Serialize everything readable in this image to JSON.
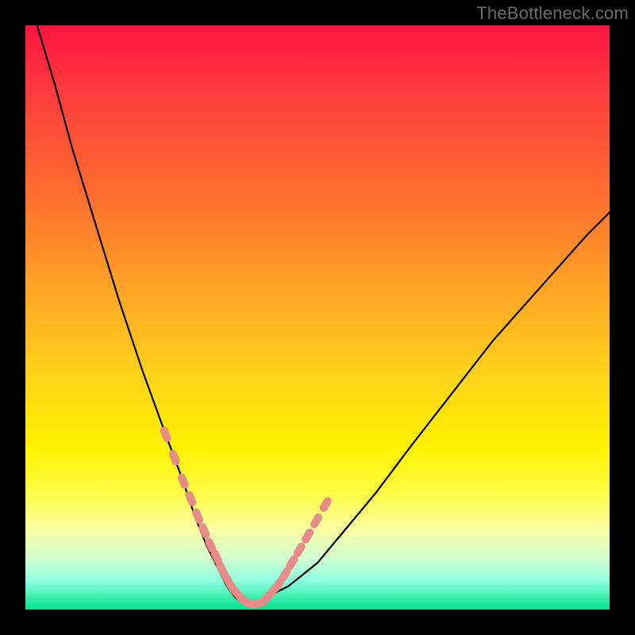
{
  "watermark": "TheBottleneck.com",
  "colors": {
    "background": "#000000",
    "curve_stroke": "#000000",
    "marker_fill": "#e98b8b",
    "gradient_top": "#ff1440",
    "gradient_bottom": "#00e18a"
  },
  "chart_data": {
    "type": "line",
    "title": "",
    "xlabel": "",
    "ylabel": "",
    "xlim": [
      0,
      100
    ],
    "ylim": [
      0,
      100
    ],
    "grid": false,
    "legend": false,
    "series": [
      {
        "name": "bottleneck-curve",
        "x": [
          2,
          5,
          8,
          12,
          16,
          20,
          24,
          27,
          29,
          31,
          33,
          34.5,
          36,
          37.5,
          39,
          41,
          45,
          50,
          55,
          60,
          66,
          73,
          80,
          88,
          96,
          100
        ],
        "y": [
          100,
          90,
          79,
          66,
          53,
          41,
          30,
          22,
          16,
          11,
          7,
          4,
          2,
          1,
          1,
          2,
          4,
          8,
          14,
          20,
          28,
          37,
          46,
          55,
          64,
          68
        ]
      }
    ],
    "markers": {
      "name": "highlighted-points",
      "comment": "pink capsule markers along the lower portion of the V curve",
      "x": [
        24,
        25.5,
        27,
        28.3,
        29.5,
        30.6,
        31.7,
        32.7,
        33.6,
        34.5,
        35.4,
        36.3,
        37.2,
        38.1,
        39,
        40,
        41,
        42,
        43.2,
        44.4,
        45.6,
        46.9,
        48.3,
        49.8,
        51.4
      ],
      "y": [
        30,
        26,
        22,
        19,
        16,
        13.5,
        11,
        9,
        7,
        5.3,
        3.8,
        2.7,
        1.8,
        1.2,
        1,
        1.1,
        1.7,
        2.8,
        4.2,
        6,
        8,
        10.2,
        12.6,
        15.2,
        18
      ]
    }
  }
}
